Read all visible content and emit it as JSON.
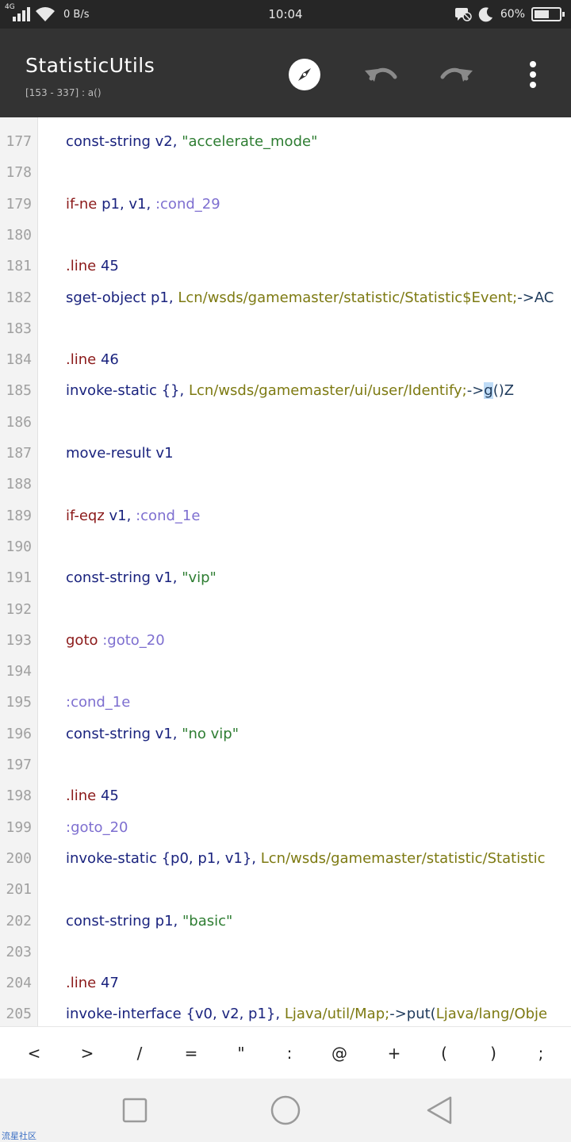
{
  "status_bar": {
    "network": "4G",
    "speed": "0 B/s",
    "time": "10:04",
    "battery": "60%",
    "battery_level": 0.6
  },
  "toolbar": {
    "title": "StatisticUtils",
    "subtitle": "[153 - 337] : a()"
  },
  "editor": {
    "lines": [
      {
        "n": "177",
        "tokens": [
          {
            "c": "t-op",
            "t": "const-string "
          },
          {
            "c": "t-reg",
            "t": "v2"
          },
          {
            "c": "t-punct",
            "t": ", "
          },
          {
            "c": "t-str",
            "t": "\"accelerate_mode\""
          }
        ]
      },
      {
        "n": "178",
        "tokens": []
      },
      {
        "n": "179",
        "tokens": [
          {
            "c": "t-branch",
            "t": "if-ne "
          },
          {
            "c": "t-reg",
            "t": "p1"
          },
          {
            "c": "t-punct",
            "t": ", "
          },
          {
            "c": "t-reg",
            "t": "v1"
          },
          {
            "c": "t-punct",
            "t": ", "
          },
          {
            "c": "t-label",
            "t": ":cond_29"
          }
        ]
      },
      {
        "n": "180",
        "tokens": []
      },
      {
        "n": "181",
        "tokens": [
          {
            "c": "t-dir",
            "t": ".line "
          },
          {
            "c": "t-num",
            "t": "45"
          }
        ]
      },
      {
        "n": "182",
        "tokens": [
          {
            "c": "t-op",
            "t": "sget-object "
          },
          {
            "c": "t-reg",
            "t": "p1"
          },
          {
            "c": "t-punct",
            "t": ", "
          },
          {
            "c": "t-type",
            "t": "Lcn/wsds/gamemaster/statistic/Statistic$Event;"
          },
          {
            "c": "t-arrow",
            "t": "->AC"
          }
        ]
      },
      {
        "n": "183",
        "tokens": []
      },
      {
        "n": "184",
        "tokens": [
          {
            "c": "t-dir",
            "t": ".line "
          },
          {
            "c": "t-num",
            "t": "46"
          }
        ]
      },
      {
        "n": "185",
        "tokens": [
          {
            "c": "t-op",
            "t": "invoke-static "
          },
          {
            "c": "t-punct",
            "t": "{}, "
          },
          {
            "c": "t-type",
            "t": "Lcn/wsds/gamemaster/ui/user/Identify;"
          },
          {
            "c": "t-arrow",
            "t": "->"
          },
          {
            "c": "cursor-hl",
            "t": "g"
          },
          {
            "c": "t-arrow",
            "t": "()Z"
          }
        ]
      },
      {
        "n": "186",
        "tokens": []
      },
      {
        "n": "187",
        "tokens": [
          {
            "c": "t-op",
            "t": "move-result "
          },
          {
            "c": "t-reg",
            "t": "v1"
          }
        ]
      },
      {
        "n": "188",
        "tokens": []
      },
      {
        "n": "189",
        "tokens": [
          {
            "c": "t-branch",
            "t": "if-eqz "
          },
          {
            "c": "t-reg",
            "t": "v1"
          },
          {
            "c": "t-punct",
            "t": ", "
          },
          {
            "c": "t-label",
            "t": ":cond_1e"
          }
        ]
      },
      {
        "n": "190",
        "tokens": []
      },
      {
        "n": "191",
        "tokens": [
          {
            "c": "t-op",
            "t": "const-string "
          },
          {
            "c": "t-reg",
            "t": "v1"
          },
          {
            "c": "t-punct",
            "t": ", "
          },
          {
            "c": "t-str",
            "t": "\"vip\""
          }
        ]
      },
      {
        "n": "192",
        "tokens": []
      },
      {
        "n": "193",
        "tokens": [
          {
            "c": "t-branch",
            "t": "goto "
          },
          {
            "c": "t-label",
            "t": ":goto_20"
          }
        ]
      },
      {
        "n": "194",
        "tokens": []
      },
      {
        "n": "195",
        "tokens": [
          {
            "c": "t-label",
            "t": ":cond_1e"
          }
        ]
      },
      {
        "n": "196",
        "tokens": [
          {
            "c": "t-op",
            "t": "const-string "
          },
          {
            "c": "t-reg",
            "t": "v1"
          },
          {
            "c": "t-punct",
            "t": ", "
          },
          {
            "c": "t-str",
            "t": "\"no vip\""
          }
        ]
      },
      {
        "n": "197",
        "tokens": []
      },
      {
        "n": "198",
        "tokens": [
          {
            "c": "t-dir",
            "t": ".line "
          },
          {
            "c": "t-num",
            "t": "45"
          }
        ]
      },
      {
        "n": "199",
        "tokens": [
          {
            "c": "t-label",
            "t": ":goto_20"
          }
        ]
      },
      {
        "n": "200",
        "tokens": [
          {
            "c": "t-op",
            "t": "invoke-static "
          },
          {
            "c": "t-punct",
            "t": "{"
          },
          {
            "c": "t-reg",
            "t": "p0"
          },
          {
            "c": "t-punct",
            "t": ", "
          },
          {
            "c": "t-reg",
            "t": "p1"
          },
          {
            "c": "t-punct",
            "t": ", "
          },
          {
            "c": "t-reg",
            "t": "v1"
          },
          {
            "c": "t-punct",
            "t": "}, "
          },
          {
            "c": "t-type",
            "t": "Lcn/wsds/gamemaster/statistic/Statistic"
          }
        ]
      },
      {
        "n": "201",
        "tokens": []
      },
      {
        "n": "202",
        "tokens": [
          {
            "c": "t-op",
            "t": "const-string "
          },
          {
            "c": "t-reg",
            "t": "p1"
          },
          {
            "c": "t-punct",
            "t": ", "
          },
          {
            "c": "t-str",
            "t": "\"basic\""
          }
        ]
      },
      {
        "n": "203",
        "tokens": []
      },
      {
        "n": "204",
        "tokens": [
          {
            "c": "t-dir",
            "t": ".line "
          },
          {
            "c": "t-num",
            "t": "47"
          }
        ]
      },
      {
        "n": "205",
        "tokens": [
          {
            "c": "t-op",
            "t": "invoke-interface "
          },
          {
            "c": "t-punct",
            "t": "{"
          },
          {
            "c": "t-reg",
            "t": "v0"
          },
          {
            "c": "t-punct",
            "t": ", "
          },
          {
            "c": "t-reg",
            "t": "v2"
          },
          {
            "c": "t-punct",
            "t": ", "
          },
          {
            "c": "t-reg",
            "t": "p1"
          },
          {
            "c": "t-punct",
            "t": "}, "
          },
          {
            "c": "t-type",
            "t": "Ljava/util/Map;"
          },
          {
            "c": "t-arrow",
            "t": "->put("
          },
          {
            "c": "t-type",
            "t": "Ljava/lang/Obje"
          }
        ]
      }
    ]
  },
  "symbols": [
    "<",
    ">",
    "/",
    "=",
    "\"",
    ":",
    "@",
    "+",
    "(",
    ")",
    ";"
  ],
  "watermark": "流星社区"
}
